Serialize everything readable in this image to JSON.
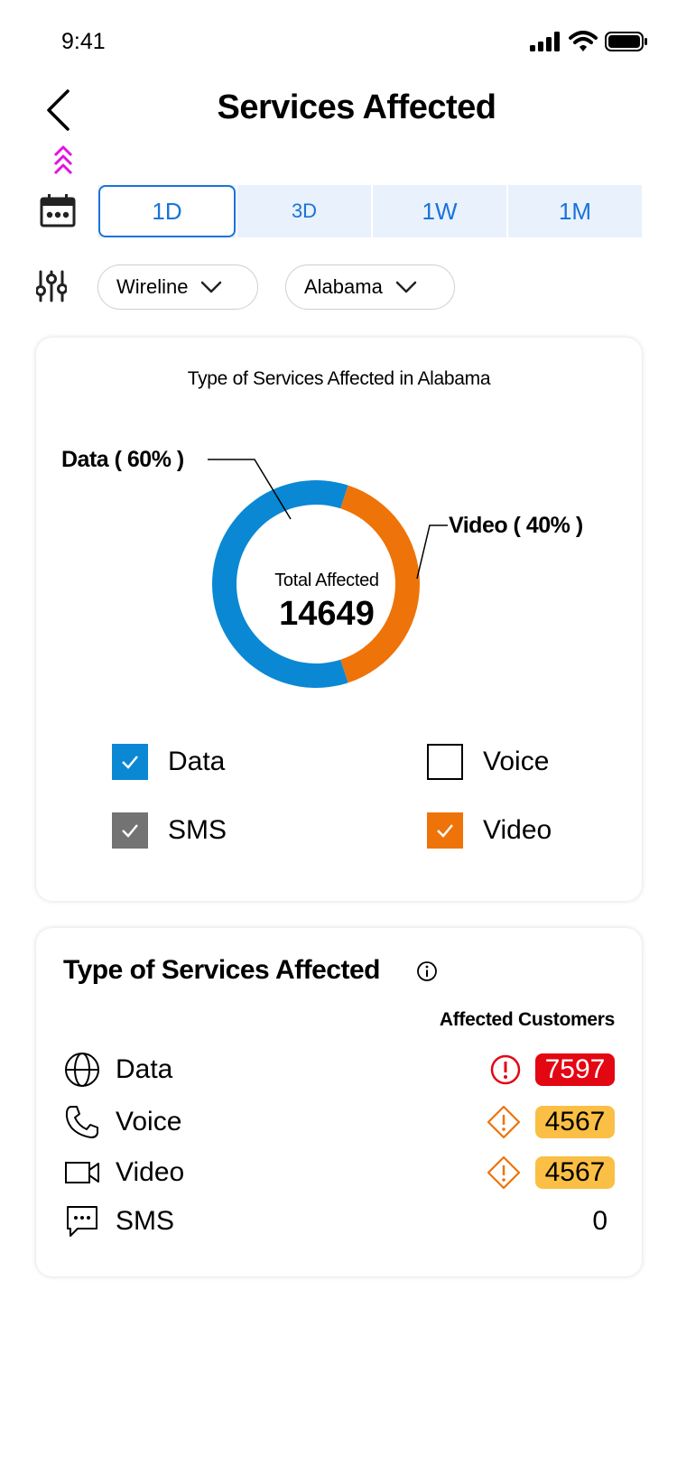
{
  "status_bar": {
    "time": "9:41"
  },
  "header": {
    "title": "Services Affected"
  },
  "time_range": {
    "options": [
      {
        "label": "1D",
        "active": true
      },
      {
        "label": "3D",
        "active": false
      },
      {
        "label": "1W",
        "active": false
      },
      {
        "label": "1M",
        "active": false
      }
    ]
  },
  "filters": {
    "region": "Wireline",
    "state": "Alabama"
  },
  "chart_card": {
    "title": "Type of Services Affected in Alabama",
    "center_label": "Total Affected",
    "center_value": "14649"
  },
  "chart_data": {
    "type": "pie",
    "title": "Type of Services Affected in Alabama",
    "categories": [
      "Data",
      "Video"
    ],
    "values": [
      60,
      40
    ],
    "value_labels": [
      "Data ( 60% )",
      "Video ( 40% )"
    ],
    "colors": [
      "#0a88d4",
      "#ee7308"
    ]
  },
  "legend": {
    "items": [
      {
        "label": "Data",
        "checked": true,
        "color": "#0a88d4"
      },
      {
        "label": "Voice",
        "checked": false,
        "color": "#ffffff"
      },
      {
        "label": "SMS",
        "checked": true,
        "color": "#737373"
      },
      {
        "label": "Video",
        "checked": true,
        "color": "#ee7308"
      }
    ]
  },
  "table_card": {
    "title": "Type of Services Affected",
    "column_header": "Affected Customers",
    "rows": [
      {
        "label": "Data",
        "icon": "globe-icon",
        "count": "7597",
        "severity": "critical"
      },
      {
        "label": "Voice",
        "icon": "phone-icon",
        "count": "4567",
        "severity": "warning"
      },
      {
        "label": "Video",
        "icon": "video-icon",
        "count": "4567",
        "severity": "warning"
      },
      {
        "label": "SMS",
        "icon": "message-icon",
        "count": "0",
        "severity": "none"
      }
    ]
  }
}
